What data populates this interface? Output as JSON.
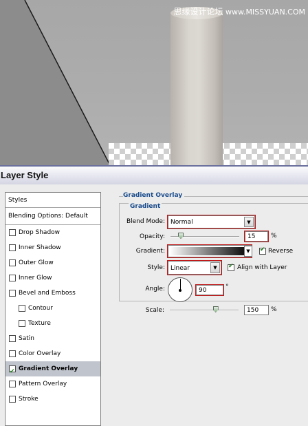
{
  "watermark": {
    "cn": "思缘设计论坛",
    "url": "www.MISSYUAN.COM"
  },
  "dialog": {
    "title": "Layer Style"
  },
  "styles_panel": {
    "header": "Styles",
    "blending": "Blending Options: Default",
    "items": [
      {
        "label": "Drop Shadow",
        "checked": false,
        "indent": false,
        "selected": false
      },
      {
        "label": "Inner Shadow",
        "checked": false,
        "indent": false,
        "selected": false
      },
      {
        "label": "Outer Glow",
        "checked": false,
        "indent": false,
        "selected": false
      },
      {
        "label": "Inner Glow",
        "checked": false,
        "indent": false,
        "selected": false
      },
      {
        "label": "Bevel and Emboss",
        "checked": false,
        "indent": false,
        "selected": false
      },
      {
        "label": "Contour",
        "checked": false,
        "indent": true,
        "selected": false
      },
      {
        "label": "Texture",
        "checked": false,
        "indent": true,
        "selected": false
      },
      {
        "label": "Satin",
        "checked": false,
        "indent": false,
        "selected": false
      },
      {
        "label": "Color Overlay",
        "checked": false,
        "indent": false,
        "selected": false
      },
      {
        "label": "Gradient Overlay",
        "checked": true,
        "indent": false,
        "selected": true
      },
      {
        "label": "Pattern Overlay",
        "checked": false,
        "indent": false,
        "selected": false
      },
      {
        "label": "Stroke",
        "checked": false,
        "indent": false,
        "selected": false
      }
    ]
  },
  "gradient_overlay": {
    "section_title": "Gradient Overlay",
    "subsection_title": "Gradient",
    "blend_mode_label": "Blend Mode:",
    "blend_mode_value": "Normal",
    "opacity_label": "Opacity:",
    "opacity_value": "15",
    "opacity_percent": 15,
    "percent_sign": "%",
    "gradient_label": "Gradient:",
    "reverse_label": "Reverse",
    "reverse_checked": true,
    "style_label": "Style:",
    "style_value": "Linear",
    "align_label": "Align with Layer",
    "align_checked": true,
    "angle_label": "Angle:",
    "angle_value": "90",
    "degree_sign": "°",
    "scale_label": "Scale:",
    "scale_value": "150",
    "scale_fraction": 0.667
  },
  "colors": {
    "group_title": "#1b4c8c",
    "highlight_outline": "#c21818",
    "selected_row": "#c0c4cc"
  }
}
